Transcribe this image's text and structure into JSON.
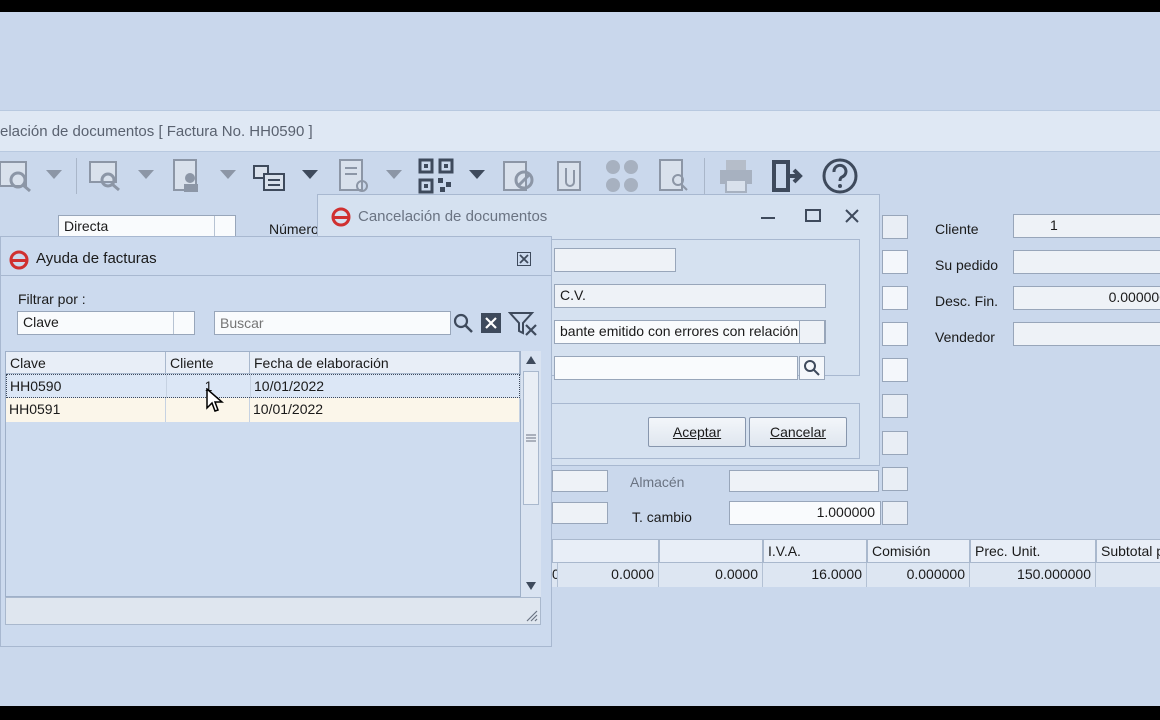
{
  "main_window": {
    "title": "elación de documentos [ Factura No. HH0590 ]",
    "tipo_value": "Directa",
    "numero_label": "Número",
    "right_fields": {
      "cliente_label": "Cliente",
      "cliente_value": "1",
      "su_pedido_label": "Su pedido",
      "su_pedido_value": "",
      "desc_fin_label": "Desc. Fin.",
      "desc_fin_value": "0.000000",
      "vendedor_label": "Vendedor",
      "vendedor_value": ""
    },
    "almacen_label": "Almacén",
    "almacen_value": "",
    "t_cambio_label": "T. cambio",
    "t_cambio_value": "1.000000",
    "items_grid": {
      "headers": [
        "",
        "",
        "I.V.A.",
        "Comisión",
        "Prec. Unit.",
        "Subtotal p"
      ],
      "row": [
        "0",
        "0.0000",
        "0.0000",
        "16.0000",
        "0.000000",
        "150.000000",
        ""
      ]
    }
  },
  "cancel_dialog": {
    "title": "Cancelación de documentos",
    "field1_value": "",
    "field2_value": "C.V.",
    "motivo_value": "bante emitido con errores con relación.",
    "folio_value": "",
    "accept_label": "Aceptar",
    "cancel_label": "Cancelar"
  },
  "help_dialog": {
    "title": "Ayuda de facturas",
    "filter_label": "Filtrar por :",
    "filter_value": "Clave",
    "search_placeholder": "Buscar",
    "columns": [
      "Clave",
      "Cliente",
      "Fecha de elaboración"
    ],
    "rows": [
      {
        "clave": "HH0590",
        "cliente": "1",
        "fecha": "10/01/2022"
      },
      {
        "clave": "HH0591",
        "cliente": "",
        "fecha": "10/01/2022"
      }
    ]
  },
  "colors": {
    "background": "#cad8ec",
    "selected_row": "#dce7f6",
    "alt_row": "#fbf6ea"
  }
}
